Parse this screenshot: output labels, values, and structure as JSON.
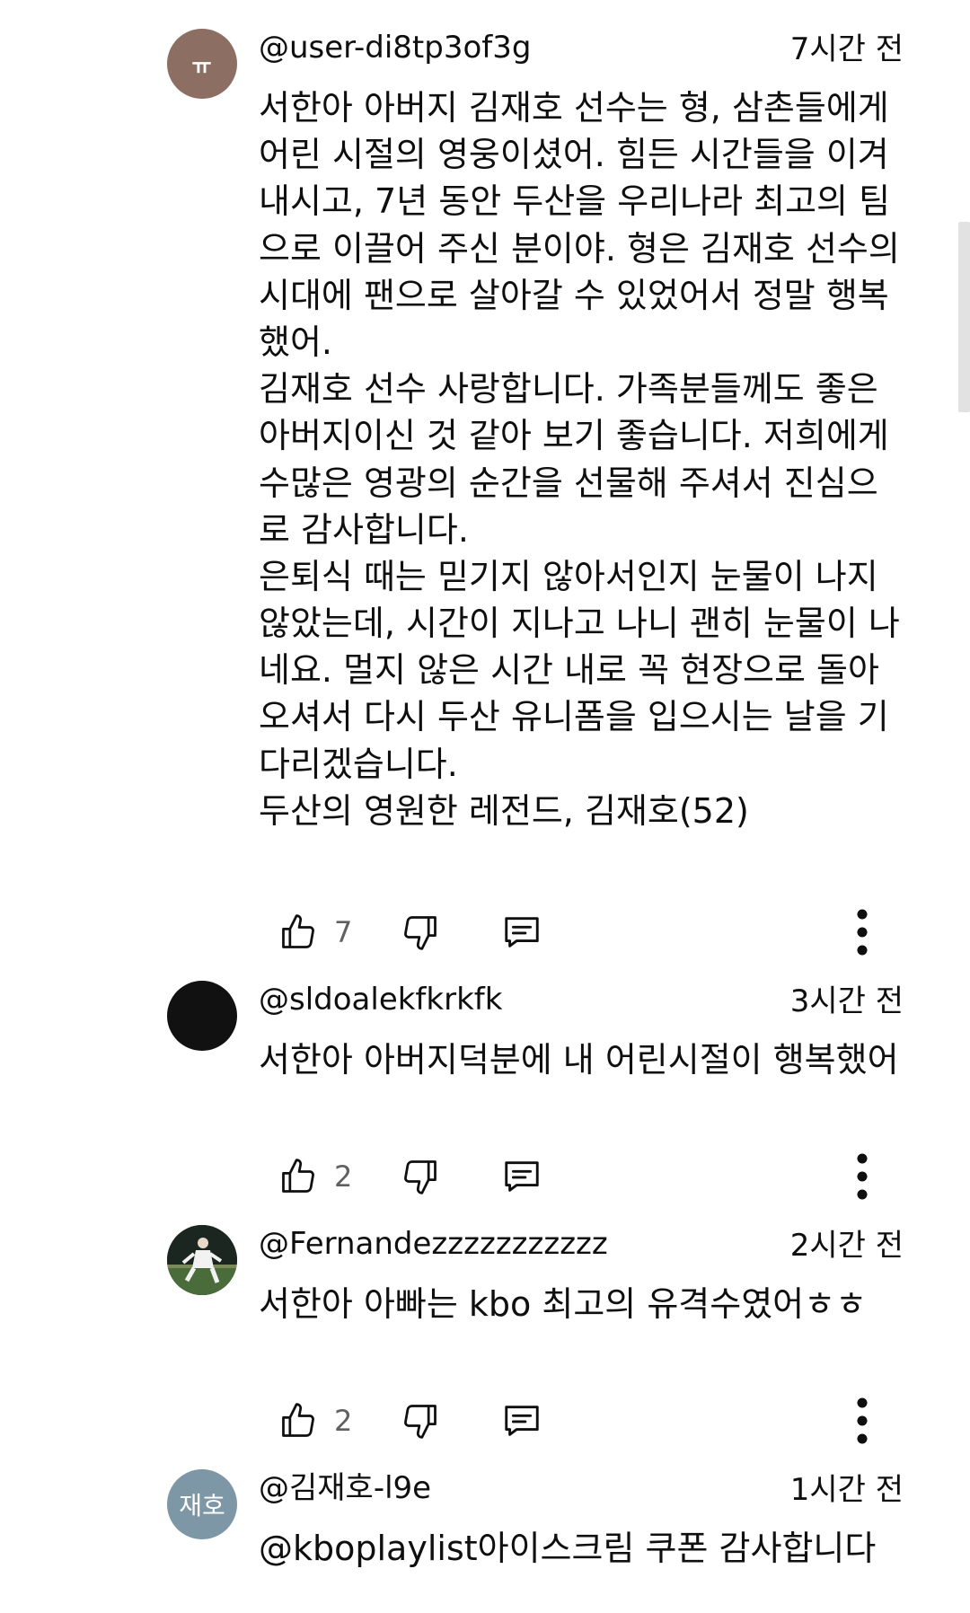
{
  "comments": [
    {
      "avatar": {
        "initials": "ㅠ",
        "color": "#8d6e63"
      },
      "handle": "@user-di8tp3of3g",
      "time": "7시간 전",
      "lines": [
        "서한아 아버지 김재호 선수는 형, 삼촌들에게",
        "어린 시절의 영웅이셨어. 힘든 시간들을 이겨",
        "내시고, 7년 동안 두산을 우리나라 최고의 팀",
        "으로 이끌어 주신 분이야. 형은 김재호 선수의",
        "시대에 팬으로 살아갈 수 있었어서 정말 행복",
        "했어.",
        "김재호 선수 사랑합니다. 가족분들께도 좋은",
        "아버지이신 것 같아 보기 좋습니다. 저희에게",
        "수많은 영광의 순간을 선물해 주셔서 진심으",
        "로 감사합니다.",
        "은퇴식 때는 믿기지 않아서인지 눈물이 나지",
        "않았는데, 시간이 지나고 나니 괜히 눈물이 나",
        "네요. 멀지 않은 시간 내로 꼭 현장으로 돌아",
        "오셔서 다시 두산 유니폼을 입으시는 날을 기",
        "다리겠습니다.",
        "두산의 영원한 레전드, 김재호(52)"
      ],
      "likes": "7"
    },
    {
      "avatar": {
        "initials": "",
        "color": "#111111"
      },
      "handle": "@sldoalekfkrkfk",
      "time": "3시간 전",
      "lines": [
        "서한아 아버지덕분에 내 어린시절이 행복했어"
      ],
      "likes": "2"
    },
    {
      "avatar": {
        "initials": "",
        "color": "#2d3a2a"
      },
      "handle": "@Fernandezzzzzzzzzzz",
      "time": "2시간 전",
      "lines": [
        "서한아 아빠는 kbo 최고의 유격수였어ㅎㅎ"
      ],
      "likes": "2"
    },
    {
      "avatar": {
        "initials": "재호",
        "color": "#7e97a6"
      },
      "handle": "@김재호-l9e",
      "time": "1시간 전",
      "lines": [
        "@kboplaylist아이스크림 쿠폰 감사합니다"
      ]
    }
  ],
  "icons": {
    "like": "thumb-up-icon",
    "dislike": "thumb-down-icon",
    "reply": "reply-icon",
    "more": "more-vert-icon"
  }
}
